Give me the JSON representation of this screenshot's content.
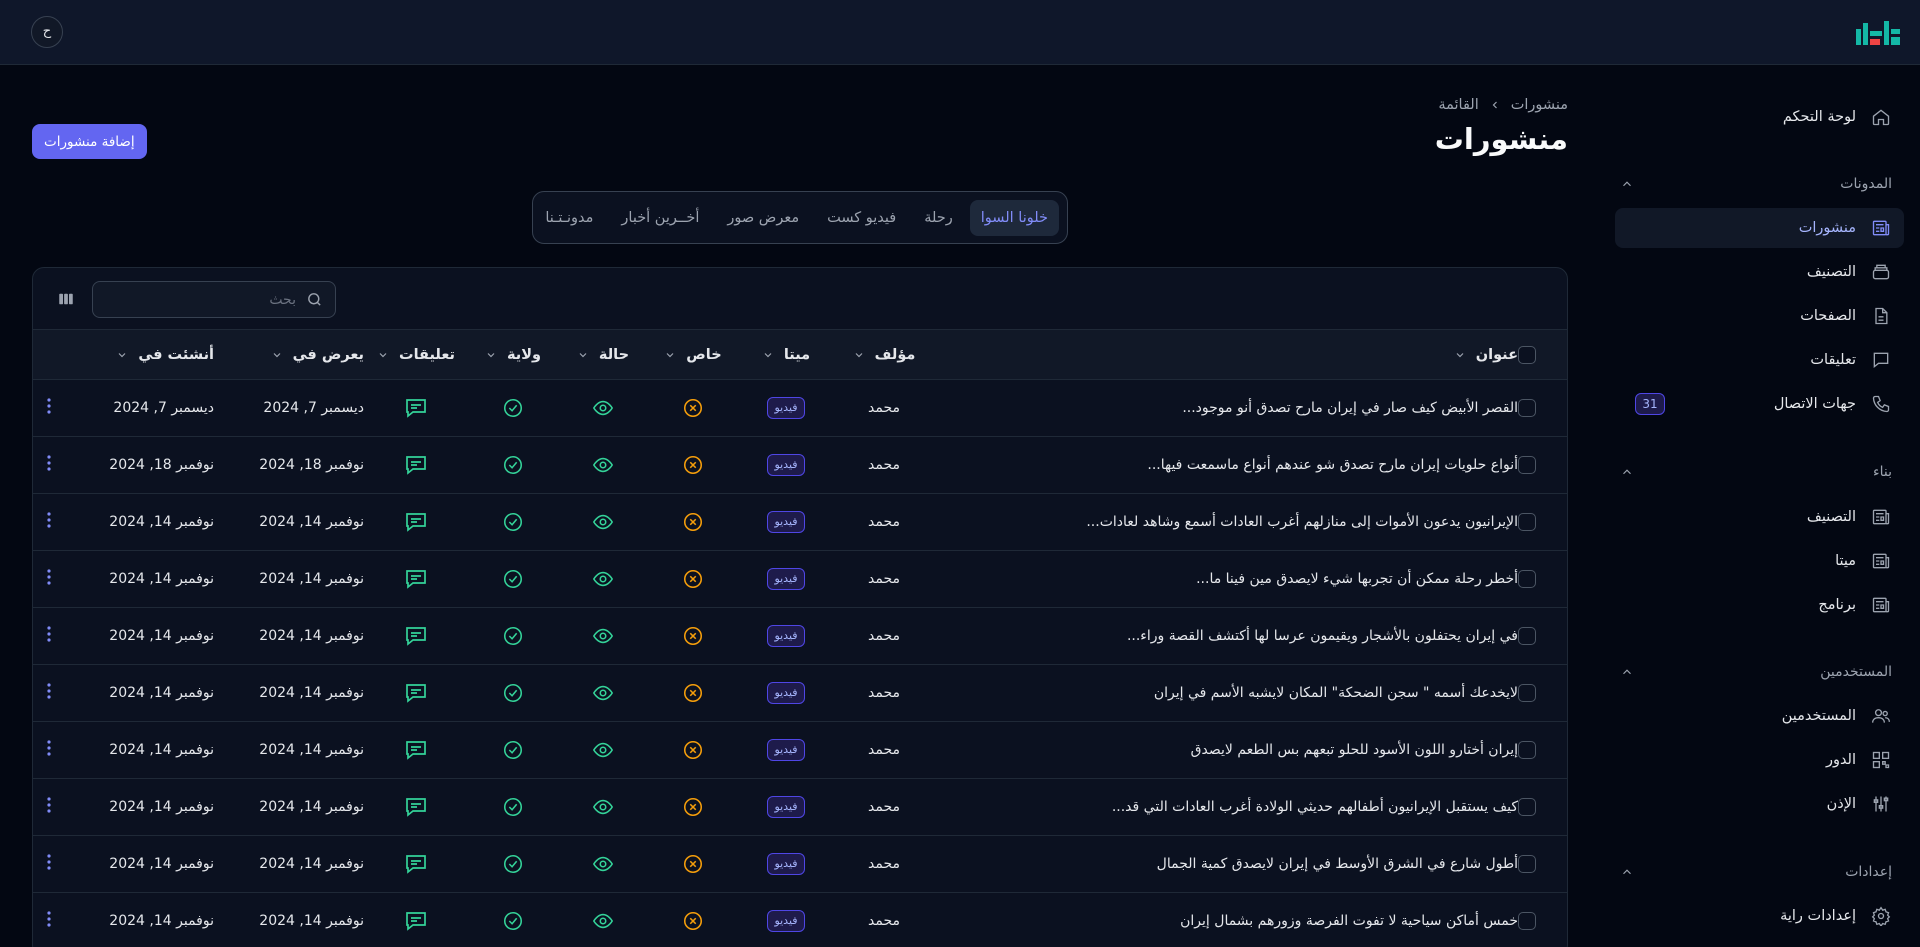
{
  "header": {
    "avatar_initial": "ح"
  },
  "sidebar": {
    "dashboard": {
      "label": "لوحة التحكم",
      "icon": "home-icon"
    },
    "groups": [
      {
        "label": "المدونات",
        "items": [
          {
            "label": "منشورات",
            "icon": "newspaper-icon",
            "active": true
          },
          {
            "label": "التصنيف",
            "icon": "stack-icon"
          },
          {
            "label": "الصفحات",
            "icon": "document-icon"
          },
          {
            "label": "تعليقات",
            "icon": "chat-icon"
          },
          {
            "label": "جهات الاتصال",
            "icon": "phone-icon",
            "badge": "31"
          }
        ]
      },
      {
        "label": "بناء",
        "items": [
          {
            "label": "التصنيف",
            "icon": "newspaper-icon"
          },
          {
            "label": "ميتا",
            "icon": "newspaper-icon"
          },
          {
            "label": "برنامج",
            "icon": "newspaper-icon"
          }
        ]
      },
      {
        "label": "المستخدمين",
        "items": [
          {
            "label": "المستخدمين",
            "icon": "users-icon"
          },
          {
            "label": "الدور",
            "icon": "qr-icon"
          },
          {
            "label": "الإذن",
            "icon": "sliders-icon"
          }
        ]
      },
      {
        "label": "إعدادات",
        "items": [
          {
            "label": "إعدادات راية",
            "icon": "gear-icon"
          }
        ]
      }
    ]
  },
  "breadcrumb": {
    "root": "منشورات",
    "current": "القائمة"
  },
  "page": {
    "title": "منشورات",
    "add_button": "إضافة منشورات"
  },
  "tabs": [
    "خلونا السوا",
    "رحلة",
    "فيديو كست",
    "معرض صور",
    "أخــرين أخبار",
    "مدونـتـنا"
  ],
  "search": {
    "placeholder": "بحث"
  },
  "table": {
    "headers": {
      "title": "عنوان",
      "author": "مؤلف",
      "meta": "ميتا",
      "private": "خاص",
      "status": "حالة",
      "state": "ولاية",
      "comments": "تعليقات",
      "shown_in": "يعرض في",
      "created_at": "أنشئت في"
    },
    "rows": [
      {
        "title": "القصر الأبيض كيف صار في إيران مارح تصدق أنو موجود...",
        "author": "محمد",
        "meta": "فيديو",
        "shown_in": "ديسمبر 7, 2024",
        "created_at": "ديسمبر 7, 2024"
      },
      {
        "title": "أنواع حلويات إيران مارح تصدق شو عندهم أنواع ماسمعت فيها...",
        "author": "محمد",
        "meta": "فيديو",
        "shown_in": "نوفمبر 18, 2024",
        "created_at": "نوفمبر 18, 2024"
      },
      {
        "title": "الإيرانيون يدعون الأموات إلى منازلهم أغرب العادات أسمع وشاهد لعادات...",
        "author": "محمد",
        "meta": "فيديو",
        "shown_in": "نوفمبر 14, 2024",
        "created_at": "نوفمبر 14, 2024"
      },
      {
        "title": "أخطر رحلة ممكن أن تجربها شيء لايصدق مين فينا ما...",
        "author": "محمد",
        "meta": "فيديو",
        "shown_in": "نوفمبر 14, 2024",
        "created_at": "نوفمبر 14, 2024"
      },
      {
        "title": "في إيران يحتفلون بالأشجار ويقيمون عرسا لها أكتشف القصة وراء...",
        "author": "محمد",
        "meta": "فيديو",
        "shown_in": "نوفمبر 14, 2024",
        "created_at": "نوفمبر 14, 2024"
      },
      {
        "title": "لايخدعك أسمه \" سجن الضحكة\" المكان لايشبه الأسم في إيران",
        "author": "محمد",
        "meta": "فيديو",
        "shown_in": "نوفمبر 14, 2024",
        "created_at": "نوفمبر 14, 2024"
      },
      {
        "title": "إيران أختارو اللون الأسود للحلو تبعهم بس الطعم لايصدق",
        "author": "محمد",
        "meta": "فيديو",
        "shown_in": "نوفمبر 14, 2024",
        "created_at": "نوفمبر 14, 2024"
      },
      {
        "title": "كيف يستقبل الإيرانيون أطفالهم حديثي الولادة أغرب العادات التي قد...",
        "author": "محمد",
        "meta": "فيديو",
        "shown_in": "نوفمبر 14, 2024",
        "created_at": "نوفمبر 14, 2024"
      },
      {
        "title": "أطول شارع في الشرق الأوسط في إيران لايصدق كمية الجمال",
        "author": "محمد",
        "meta": "فيديو",
        "shown_in": "نوفمبر 14, 2024",
        "created_at": "نوفمبر 14, 2024"
      },
      {
        "title": "خمس أماكن سياحية لا تفوت الفرصة وزورهم بشمال إيران",
        "author": "محمد",
        "meta": "فيديو",
        "shown_in": "نوفمبر 14, 2024",
        "created_at": "نوفمبر 14, 2024"
      }
    ]
  },
  "colors": {
    "accent": "#6366f1",
    "orange": "#f59e0b",
    "green": "#34d399",
    "background": "#030712"
  }
}
